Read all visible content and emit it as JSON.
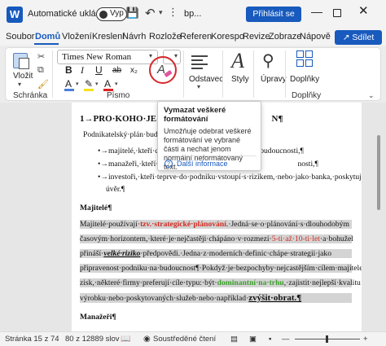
{
  "titlebar": {
    "app_icon": "word-icon",
    "app_icon_letter": "W",
    "autosave_label": "Automatické ukládání",
    "autosave_state": "Vyp",
    "doc_title": "bp...",
    "signin_label": "Přihlásit se"
  },
  "tabs": [
    "Soubor",
    "Domů",
    "Vložení",
    "Kreslení",
    "Návrh",
    "Rozložení",
    "Reference",
    "Korespondence",
    "Revize",
    "Zobrazení",
    "Nápověda"
  ],
  "tabs_visible": [
    "Soubor",
    "Domů",
    "Vložení",
    "Kreslení",
    "Návrh",
    "Rozlože",
    "Referen",
    "Korespo",
    "Revize",
    "Zobraze",
    "Nápově"
  ],
  "active_tab": "Domů",
  "share_label": "Sdílet",
  "ribbon": {
    "paste_label": "Vložit",
    "clipboard_group": "Schránka",
    "font_name": "Times New Roman",
    "bold_label": "B",
    "italic_label": "I",
    "underline_label": "U",
    "strike_label": "ab",
    "subscript_label": "x₂",
    "font_group": "Písmo",
    "paragraph_label": "Odstavec",
    "styles_label": "Styly",
    "editing_label": "Úpravy",
    "addins_label": "Doplňky",
    "addins_group": "Doplňky",
    "colors": {
      "highlight": "#f5e11b",
      "font_color": "#e02020",
      "brand": "#185abd"
    }
  },
  "tooltip": {
    "title": "Vymazat veškeré formátování",
    "text": "Umožňuje odebrat veškeré formátování ve vybrané části a nechat jenom normální neformátovaný text.",
    "link": "Další informace"
  },
  "document": {
    "heading1": "1→PRO·KOHO·JE·P",
    "heading1_end": "N¶",
    "intro": "Podnikatelský·plán·budou",
    "bullet1_start": "→majitelé,·kteří·chtě",
    "bullet1_end": "budoucnosti,¶",
    "bullet2_start": "→manažeři,·kteří·chtě",
    "bullet2_end": "nosti,¶",
    "bullet3": "→investoři,·kteří·teprve·do·podniku·vstoupí·s·rizikem,·nebo·jako·banka,·poskytující",
    "bullet3_cont": "úvěr.¶",
    "heading_owners": "Majitelé¶",
    "p1_a": "Majitelé·používají·",
    "p1_red": "tzv.·strategické·plánování",
    "p1_b": ".·Jedná·se·o·plánování·s·dlouhodobým",
    "p2_a": "časovým·horizontem,·které·je·nejčastěji·chápáno·v·rozmezí·",
    "p2_red": "5-ti·až·10-ti·let",
    "p2_b": "·a·bohužel",
    "p3_a": "přináší·",
    "p3_bold": "velké·riziko",
    "p3_b": "·předpovědi.·Jedna·z·moderních·definic·chápe·strategii·jako",
    "p4": "připravenost·podniku·na·budoucnost",
    "p4_b": "¶·Pokdyž·je·bezpochyby·nejcastějším·cílem·majitele",
    "p5_a": "zisk,·některé·firmy·preferují·cíle·typu:·být·",
    "p5_green": "dominantní·na·trhu",
    "p5_b": ",·zajistit·nejlepší·kvalitu",
    "p6_a": "výrobku·nebo·poskytovaných·služeb·nebo·například·",
    "p6_bold": "zvýšit·obrat.¶",
    "heading_managers": "Manažeři¶"
  },
  "statusbar": {
    "page": "Stránka 15 z 74",
    "words": "80 z 12889 slov",
    "focus": "Soustředěné čtení"
  }
}
